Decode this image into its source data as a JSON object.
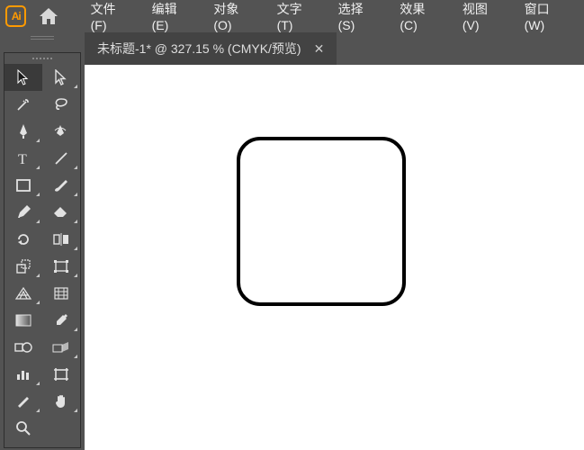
{
  "app": {
    "badge": "Ai"
  },
  "menu": {
    "file": "文件(F)",
    "edit": "编辑(E)",
    "object": "对象(O)",
    "type": "文字(T)",
    "select": "选择(S)",
    "effect": "效果(C)",
    "view": "视图(V)",
    "window": "窗口(W)"
  },
  "doc": {
    "tab_label": "未标题-1* @ 327.15 % (CMYK/预览)",
    "close": "✕",
    "zoom_percent": 327.15,
    "color_mode": "CMYK",
    "view_mode": "预览",
    "name": "未标题-1",
    "modified": true
  },
  "canvas": {
    "shape": {
      "type": "rounded-rectangle",
      "stroke": "#000000",
      "fill": "#ffffff",
      "corner_radius": 26
    }
  },
  "tools": {
    "selection": "选择工具",
    "direct_select": "直接选择工具",
    "magic_wand": "魔棒工具",
    "lasso": "套索工具",
    "pen": "钢笔工具",
    "curvature": "曲率工具",
    "type": "文字工具",
    "line": "直线段工具",
    "rect": "矩形工具",
    "brush": "画笔工具",
    "pencil": "铅笔工具",
    "eraser": "橡皮擦工具",
    "rotate": "旋转工具",
    "reflect": "镜像工具",
    "scale": "比例缩放工具",
    "free_transform": "自由变换工具",
    "perspective": "透视网格工具",
    "mesh": "网格工具",
    "gradient": "渐变工具",
    "eyedropper": "吸管工具",
    "blend": "混合工具",
    "symbol": "符号喷枪工具",
    "graph": "柱形图工具",
    "artboard": "画板工具",
    "slice": "切片工具",
    "hand": "抓手工具",
    "zoom": "缩放工具"
  }
}
